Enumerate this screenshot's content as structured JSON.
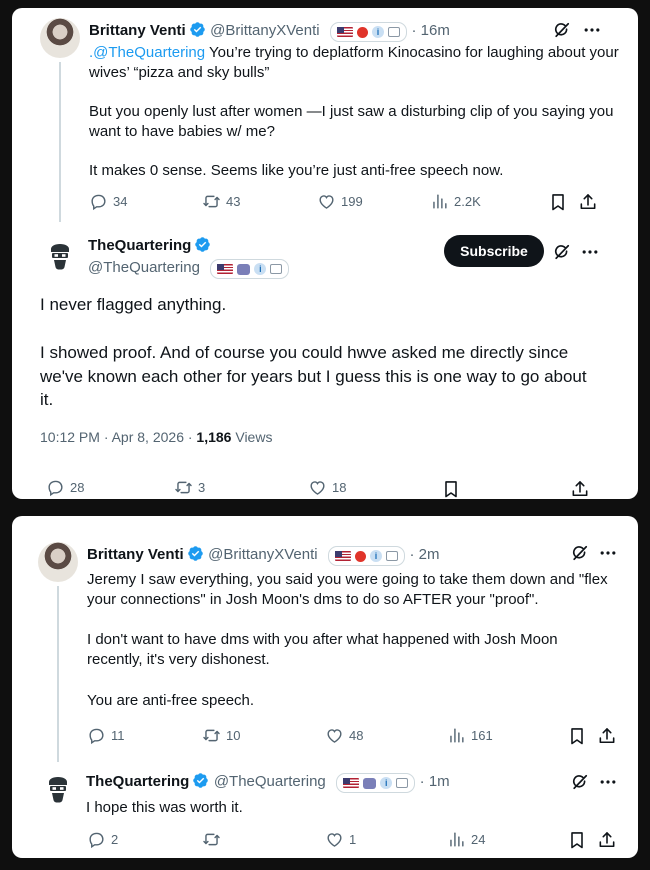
{
  "screenshot1": {
    "reply": {
      "author_name": "Brittany Venti",
      "author_handle": "@BrittanyXVenti",
      "time": "· 16m",
      "mention": ".@TheQuartering",
      "text_after_mention": " You’re trying to deplatform Kinocasino for laughing about your wives’ “pizza and sky bulls”",
      "paragraph2": "But you openly lust after women —I just saw a disturbing clip of you saying you want to have babies w/ me?",
      "paragraph3": "It makes 0 sense. Seems like you’re just anti-free speech now.",
      "replies": "34",
      "reposts": "43",
      "likes": "199",
      "views": "2.2K"
    },
    "main": {
      "author_name": "TheQuartering",
      "author_handle": "@TheQuartering",
      "subscribe_label": "Subscribe",
      "paragraph1": "I never flagged anything.",
      "paragraph2": "I showed proof. And of course you could hwve asked me directly since we've known each other for years but I guess this is one way to go about it.",
      "timestamp": "10:12 PM · Apr 8, 2026 · ",
      "views_count": "1,186",
      "views_label": " Views",
      "replies": "28",
      "reposts": "3",
      "likes": "18"
    }
  },
  "screenshot2": {
    "tweet1": {
      "author_name": "Brittany Venti",
      "author_handle": "@BrittanyXVenti",
      "time": "· 2m",
      "paragraph1": "Jeremy I saw everything, you said you were going to take them down and \"flex your connections\" in Josh Moon's dms to do so AFTER your \"proof\".",
      "paragraph2": "I don't want to have dms with you after what happened with Josh Moon recently, it's very dishonest.",
      "paragraph3": "You are anti-free speech.",
      "replies": "11",
      "reposts": "10",
      "likes": "48",
      "views": "161"
    },
    "tweet2": {
      "author_name": "TheQuartering",
      "author_handle": "@TheQuartering",
      "time": "· 1m",
      "text": "I hope this was worth it.",
      "replies": "2",
      "likes": "1",
      "views": "24"
    }
  },
  "colors": {
    "background": "#0f0f0f",
    "card": "#ffffff",
    "text": "#0f1419",
    "secondary": "#536471",
    "link": "#1d9bf0",
    "verified": "#1d9bf0",
    "subscribe_bg": "#0f1419"
  },
  "icons": [
    "verified-badge-icon",
    "grok-icon",
    "more-icon",
    "reply-icon",
    "repost-icon",
    "like-icon",
    "views-icon",
    "bookmark-icon",
    "share-icon",
    "us-flag-icon",
    "camera-icon",
    "info-icon"
  ]
}
